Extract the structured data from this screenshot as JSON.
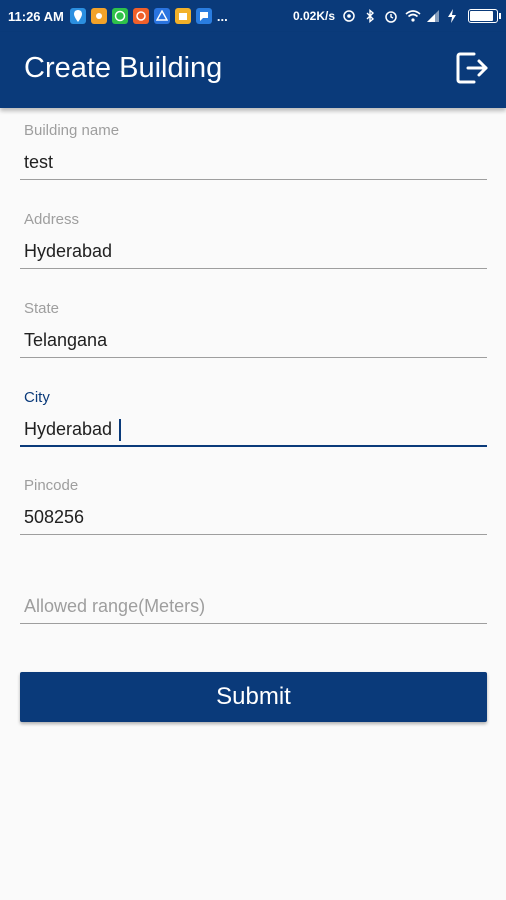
{
  "status_bar": {
    "time": "11:26 AM",
    "more_indicator": "...",
    "network_speed": "0.02K/s",
    "battery_level": 0.9,
    "notification_icons": [
      "location-pin-icon",
      "sun-icon",
      "whatsapp-icon",
      "app-icon",
      "drive-icon",
      "wallet-icon",
      "messenger-icon"
    ]
  },
  "app_bar": {
    "title": "Create Building",
    "action_icon": "logout-icon"
  },
  "form": {
    "building_name": {
      "label": "Building name",
      "value": "test"
    },
    "address": {
      "label": "Address",
      "value": "Hyderabad"
    },
    "state": {
      "label": "State",
      "value": "Telangana"
    },
    "city": {
      "label": "City",
      "value": "Hyderabad"
    },
    "pincode": {
      "label": "Pincode",
      "value": "508256"
    },
    "allowed_range": {
      "placeholder": "Allowed range(Meters)",
      "value": ""
    },
    "submit_label": "Submit"
  },
  "colors": {
    "primary": "#0a3a7a",
    "label": "#9e9e9e",
    "background": "#fafafa"
  }
}
